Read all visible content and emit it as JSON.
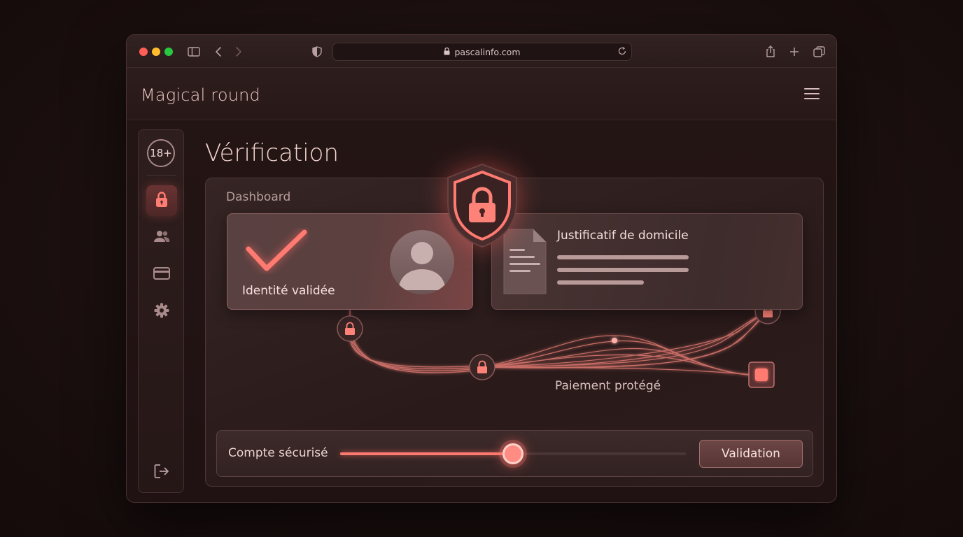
{
  "browser": {
    "url": "pascalinfo.com",
    "icons": [
      "sidebar-toggle-icon",
      "back-icon",
      "forward-icon",
      "shield-icon",
      "lock-icon",
      "reload-icon",
      "share-icon",
      "new-tab-icon",
      "tabs-icon"
    ]
  },
  "app": {
    "title": "Magical round",
    "menu_icon": "hamburger-icon"
  },
  "sidebar": {
    "badge": "18+",
    "items": [
      {
        "icon": "lock-icon",
        "active": true
      },
      {
        "icon": "users-icon",
        "active": false
      },
      {
        "icon": "card-icon",
        "active": false
      },
      {
        "icon": "gear-icon",
        "active": false
      }
    ],
    "logout_icon": "logout-icon"
  },
  "page": {
    "title": "Vérification"
  },
  "dashboard": {
    "label": "Dashboard",
    "identity_card": {
      "label": "Identité validée",
      "status": "validated"
    },
    "document_card": {
      "title": "Justificatif de domicile"
    },
    "payment": {
      "label": "Paiement protégé"
    },
    "bottom": {
      "account_label": "Compte sécurisé",
      "slider_value": 0.5,
      "button_label": "Validation"
    }
  },
  "colors": {
    "accent": "#ff7a70",
    "background": "#1c1010",
    "panel": "#2a1a1a"
  }
}
